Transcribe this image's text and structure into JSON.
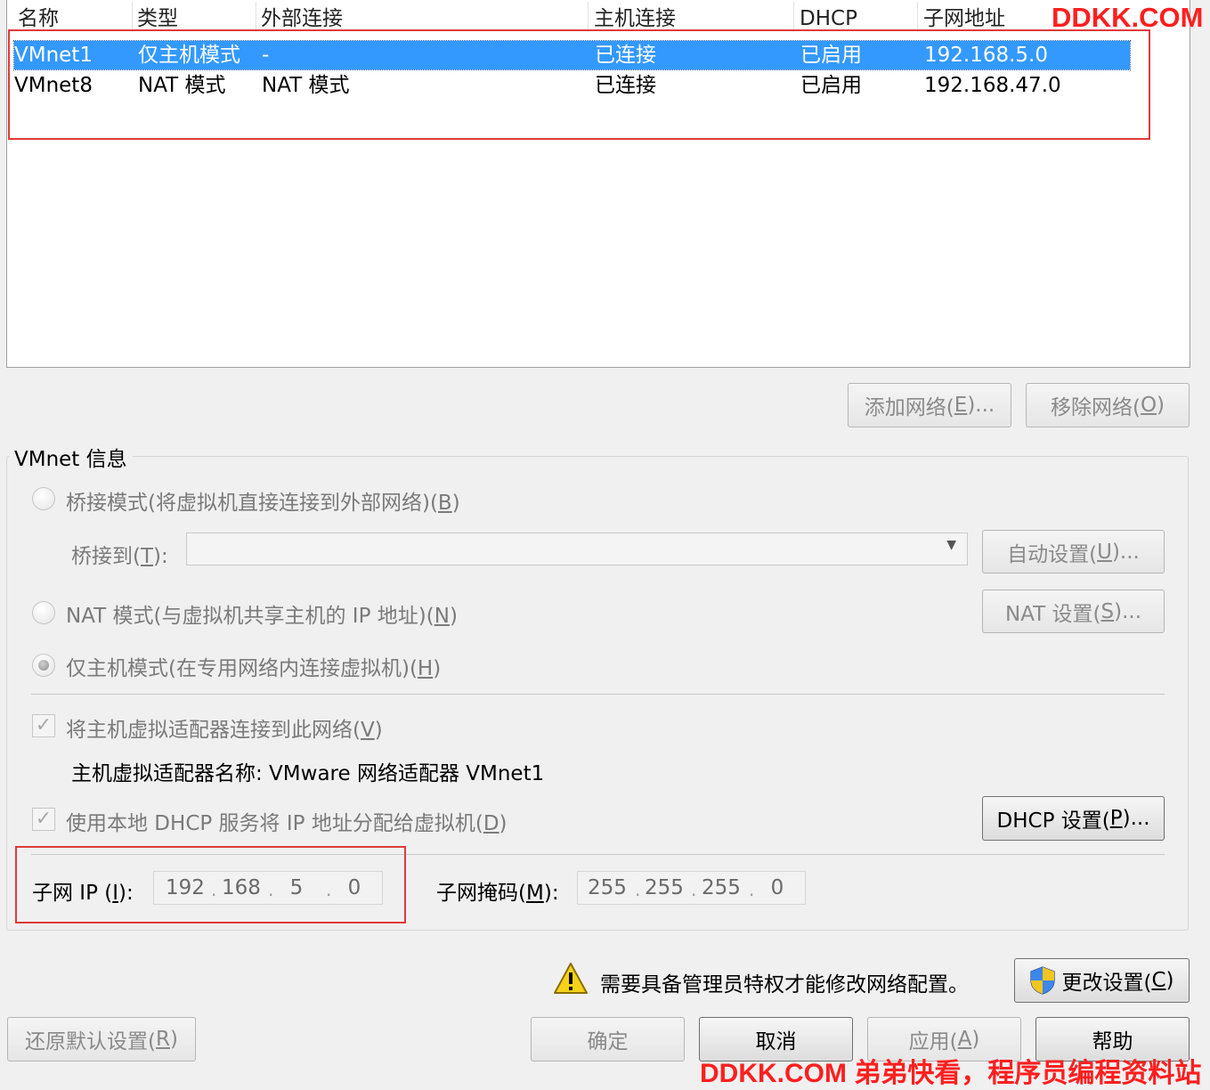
{
  "list": {
    "columns": [
      "名称",
      "类型",
      "外部连接",
      "主机连接",
      "DHCP",
      "子网地址"
    ],
    "rows": [
      {
        "name": "VMnet1",
        "type": "仅主机模式",
        "external": "-",
        "host": "已连接",
        "dhcp": "已启用",
        "subnet": "192.168.5.0",
        "selected": true
      },
      {
        "name": "VMnet8",
        "type": "NAT 模式",
        "external": "NAT 模式",
        "host": "已连接",
        "dhcp": "已启用",
        "subnet": "192.168.47.0",
        "selected": false
      }
    ]
  },
  "buttons": {
    "add_network": {
      "text": "添加网络(",
      "key": "E",
      "tail": ")..."
    },
    "remove_network": {
      "text": "移除网络(",
      "key": "O",
      "tail": ")"
    }
  },
  "vmnet_info": {
    "title": "VMnet 信息",
    "bridged": {
      "text": "桥接模式(将虚拟机直接连接到外部网络)(",
      "key": "B",
      "tail": ")"
    },
    "bridge_to": {
      "text": "桥接到(",
      "key": "T",
      "tail": "):"
    },
    "auto_settings": {
      "text": "自动设置(",
      "key": "U",
      "tail": ")..."
    },
    "nat": {
      "text": "NAT 模式(与虚拟机共享主机的 IP 地址)(",
      "key": "N",
      "tail": ")"
    },
    "nat_settings": {
      "text": "NAT 设置(",
      "key": "S",
      "tail": ")..."
    },
    "host_only": {
      "text": "仅主机模式(在专用网络内连接虚拟机)(",
      "key": "H",
      "tail": ")"
    },
    "connect_adapter": {
      "text": "将主机虚拟适配器连接到此网络(",
      "key": "V",
      "tail": ")"
    },
    "adapter_name": "主机虚拟适配器名称: VMware 网络适配器 VMnet1",
    "use_dhcp": {
      "text": "使用本地 DHCP 服务将 IP 地址分配给虚拟机(",
      "key": "D",
      "tail": ")"
    },
    "dhcp_settings": {
      "text": "DHCP 设置(",
      "key": "P",
      "tail": ")..."
    },
    "subnet_ip": {
      "label": "子网 IP (",
      "key": "I",
      "tail": "):",
      "octets": [
        "192",
        "168",
        "5",
        "0"
      ]
    },
    "subnet_mask": {
      "label": "子网掩码(",
      "key": "M",
      "tail": "):",
      "octets": [
        "255",
        "255",
        "255",
        "0"
      ]
    }
  },
  "admin": {
    "warning": "需要具备管理员特权才能修改网络配置。",
    "change_settings": {
      "text": "更改设置(",
      "key": "C",
      "tail": ")"
    }
  },
  "footer": {
    "restore_defaults": {
      "text": "还原默认设置(",
      "key": "R",
      "tail": ")"
    },
    "ok": "确定",
    "cancel": "取消",
    "apply": {
      "text": "应用(",
      "key": "A",
      "tail": ")"
    },
    "help": "帮助"
  },
  "watermark": {
    "top": "DDKK.COM",
    "bottom": "DDKK.COM 弟弟快看，程序员编程资料站"
  },
  "colors": {
    "selection": "#3399ff",
    "annotation": "#e03a3a",
    "watermark": "#ff1f1f"
  }
}
